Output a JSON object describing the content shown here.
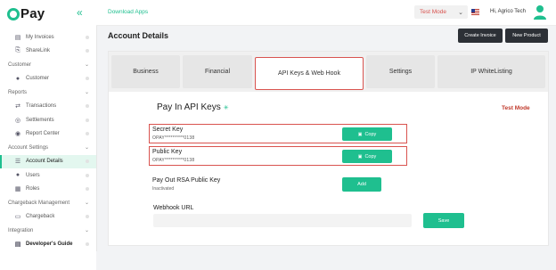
{
  "brand": {
    "logo_text": "Pay"
  },
  "sidebar": {
    "items": [
      {
        "type": "item",
        "label": "My Invoices",
        "icon": "invoice-icon"
      },
      {
        "type": "item",
        "label": "ShareLink",
        "icon": "sharelink-icon"
      },
      {
        "type": "section",
        "label": "Customer"
      },
      {
        "type": "item",
        "label": "Customer",
        "icon": "user-icon"
      },
      {
        "type": "section",
        "label": "Reports"
      },
      {
        "type": "item",
        "label": "Transactions",
        "icon": "transactions-icon"
      },
      {
        "type": "item",
        "label": "Settlements",
        "icon": "settlements-icon"
      },
      {
        "type": "item",
        "label": "Report Center",
        "icon": "report-icon"
      },
      {
        "type": "section",
        "label": "Account Settings"
      },
      {
        "type": "item",
        "label": "Account Details",
        "icon": "list-icon",
        "active": true
      },
      {
        "type": "item",
        "label": "Users",
        "icon": "users-icon"
      },
      {
        "type": "item",
        "label": "Roles",
        "icon": "roles-icon"
      },
      {
        "type": "section",
        "label": "Chargeback Management"
      },
      {
        "type": "item",
        "label": "Chargeback",
        "icon": "chargeback-icon"
      },
      {
        "type": "section",
        "label": "Integration"
      },
      {
        "type": "item",
        "label": "Developer's Guide",
        "icon": "guide-icon",
        "partial": true
      }
    ]
  },
  "topbar": {
    "download_label": "Download Apps",
    "mode_value": "Test Mode",
    "greeting": "Hi, Agrico Tech"
  },
  "header": {
    "title": "Account Details",
    "create_invoice": "Create Invoice",
    "new_product": "New Product"
  },
  "tabs": [
    {
      "label": "Business"
    },
    {
      "label": "Financial"
    },
    {
      "label": "API Keys & Web Hook",
      "active": true
    },
    {
      "label": "Settings"
    },
    {
      "label": "IP WhiteListing"
    }
  ],
  "api": {
    "title": "Pay In API Keys",
    "mode_label": "Test Mode",
    "secret_label": "Secret Key",
    "secret_value": "OPAY**********0138",
    "public_label": "Public Key",
    "public_value": "OPAY**********0138",
    "copy_label": "Copy",
    "rsa_label": "Pay Out RSA Public Key",
    "rsa_status": "Inactivated",
    "add_label": "Add",
    "webhook_label": "Webhook URL",
    "webhook_value": "",
    "save_label": "Save"
  },
  "colors": {
    "accent": "#1fbf8f",
    "dark": "#2c3036",
    "highlight": "#d9534f"
  }
}
